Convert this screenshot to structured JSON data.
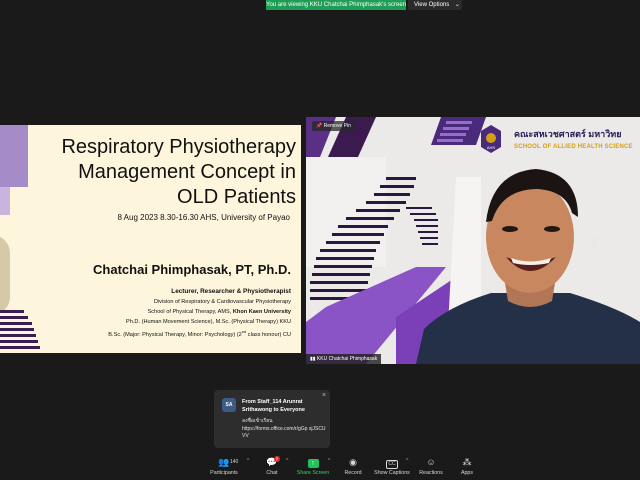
{
  "banner": {
    "viewing_text": "You are viewing KKU Chatchai Phimphasak's screen",
    "view_options_label": "View Options",
    "view_options_chevron": "⌄"
  },
  "slide": {
    "title_lines": [
      "Respiratory Physiotherapy",
      "Management Concept in",
      "OLD Patients"
    ],
    "date_line": "8 Aug 2023 8.30-16.30 AHS, University of Payao",
    "author": "Chatchai  Phimphasak, PT, Ph.D.",
    "role": "Lecturer, Researcher & Physiotherapist",
    "division": "Division of Respiratory & Cardiovascular Physiotherapy",
    "school_prefix": "School of Physical Therapy, AMS, ",
    "school_bold": "Khon Kaen University",
    "phd": "Ph.D.  (Human Movement Science), M.Sc. (Physical Therapy) KKU",
    "bsc_prefix": "B.Sc. (Major: Physical Therapy, Minor: Psychology) (2",
    "bsc_sup": "nd",
    "bsc_suffix": " class honour) CU"
  },
  "video": {
    "pin_label": "Remove Pin",
    "name_tag": "KKU Chatchai Phimphasak",
    "faculty_thai": "คณะสหเวชศาสตร์ มหาวิทย",
    "school_en": "SCHOOL OF ALLIED HEALTH SCIENCE",
    "logo_text": "AHS"
  },
  "notification": {
    "avatar": "SA",
    "from": "From Staff_114 Arunrat Srithawong to Everyone",
    "message_line1": "ลงชื่อเข้าเรียน",
    "message_line2": "https://forms.office.com/r/gGp sjJSCUVV",
    "close": "×"
  },
  "toolbar": {
    "participants_label": "Participants",
    "participants_count": "140",
    "chat_label": "Chat",
    "chat_badge": "2",
    "share_label": "Share Screen",
    "record_label": "Record",
    "captions_label": "Show Captions",
    "captions_icon_text": "CC",
    "reactions_label": "Reactions",
    "apps_label": "Apps",
    "caret": "^"
  },
  "colors": {
    "accent_green": "#23c05e",
    "slide_bg": "#fdf6dc",
    "purple": "#4a2a7a"
  }
}
